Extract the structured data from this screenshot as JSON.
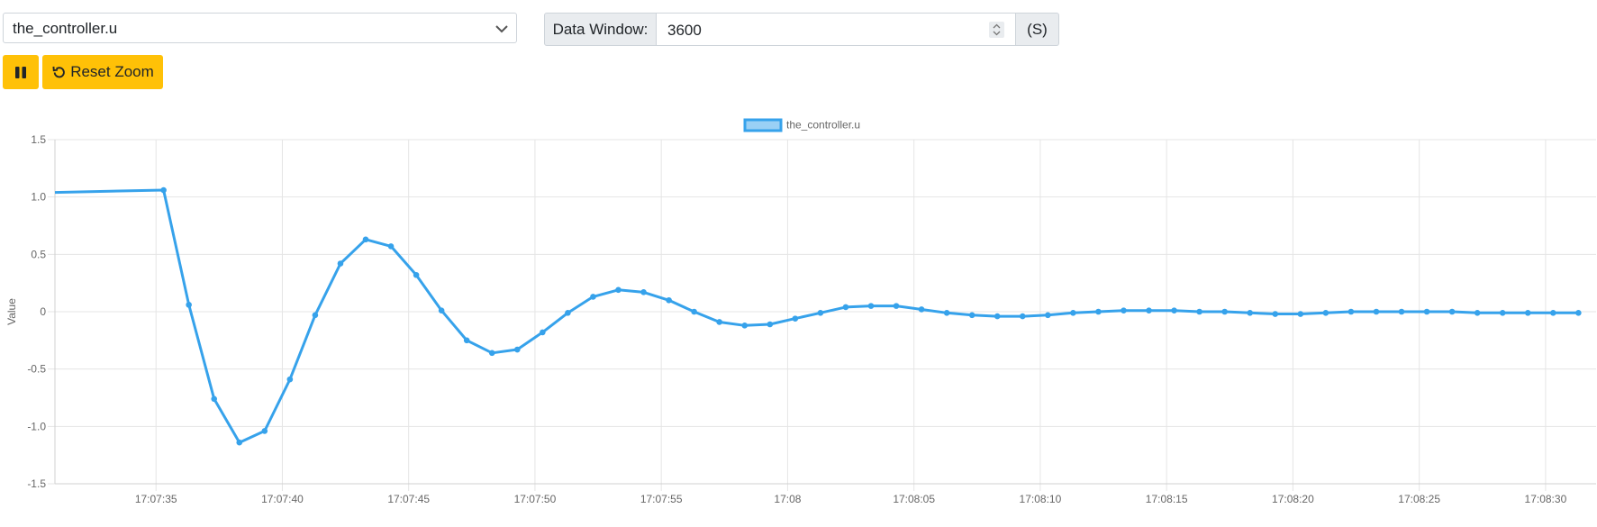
{
  "signal_select": {
    "value": "the_controller.u"
  },
  "data_window": {
    "label": "Data Window:",
    "value": "3600",
    "unit": "(S)"
  },
  "buttons": {
    "pause": "pause-icon",
    "reset_zoom": "Reset Zoom"
  },
  "colors": {
    "series": "#36a2eb",
    "series_fill": "#9ad0f5",
    "button": "#ffc107",
    "grid": "#e5e5e5"
  },
  "chart_data": {
    "type": "line",
    "ylabel": "Value",
    "ylim": [
      -1.5,
      1.5
    ],
    "yticks": [
      "1.5",
      "1.0",
      "0.5",
      "0",
      "-0.5",
      "-1.0",
      "-1.5"
    ],
    "xlim": [
      "17:07:31",
      "17:08:32"
    ],
    "xticks": [
      "17:07:35",
      "17:07:40",
      "17:07:45",
      "17:07:50",
      "17:07:55",
      "17:08",
      "17:08:05",
      "17:08:10",
      "17:08:15",
      "17:08:20",
      "17:08:25",
      "17:08:30"
    ],
    "grid": true,
    "legend_position": "top",
    "series": [
      {
        "name": "the_controller.u",
        "x": [
          "17:07:31",
          "17:07:35.3",
          "17:07:36.3",
          "17:07:37.3",
          "17:07:38.3",
          "17:07:39.3",
          "17:07:40.3",
          "17:07:41.3",
          "17:07:42.3",
          "17:07:43.3",
          "17:07:44.3",
          "17:07:45.3",
          "17:07:46.3",
          "17:07:47.3",
          "17:07:48.3",
          "17:07:49.3",
          "17:07:50.3",
          "17:07:51.3",
          "17:07:52.3",
          "17:07:53.3",
          "17:07:54.3",
          "17:07:55.3",
          "17:07:56.3",
          "17:07:57.3",
          "17:07:58.3",
          "17:07:59.3",
          "17:08:00.3",
          "17:08:01.3",
          "17:08:02.3",
          "17:08:03.3",
          "17:08:04.3",
          "17:08:05.3",
          "17:08:06.3",
          "17:08:07.3",
          "17:08:08.3",
          "17:08:09.3",
          "17:08:10.3",
          "17:08:11.3",
          "17:08:12.3",
          "17:08:13.3",
          "17:08:14.3",
          "17:08:15.3",
          "17:08:16.3",
          "17:08:17.3",
          "17:08:18.3",
          "17:08:19.3",
          "17:08:20.3",
          "17:08:21.3",
          "17:08:22.3",
          "17:08:23.3",
          "17:08:24.3",
          "17:08:25.3",
          "17:08:26.3",
          "17:08:27.3",
          "17:08:28.3",
          "17:08:29.3",
          "17:08:30.3",
          "17:08:31.3"
        ],
        "y": [
          1.04,
          1.06,
          0.06,
          -0.76,
          -1.14,
          -1.04,
          -0.59,
          -0.03,
          0.42,
          0.63,
          0.57,
          0.32,
          0.01,
          -0.25,
          -0.36,
          -0.33,
          -0.18,
          -0.01,
          0.13,
          0.19,
          0.17,
          0.1,
          0.0,
          -0.09,
          -0.12,
          -0.11,
          -0.06,
          -0.01,
          0.04,
          0.05,
          0.05,
          0.02,
          -0.01,
          -0.03,
          -0.04,
          -0.04,
          -0.03,
          -0.01,
          0.0,
          0.01,
          0.01,
          0.01,
          0.0,
          0.0,
          -0.01,
          -0.02,
          -0.02,
          -0.01,
          0.0,
          0.0,
          0.0,
          0.0,
          0.0,
          -0.01,
          -0.01,
          -0.01,
          -0.01,
          -0.01
        ]
      }
    ]
  }
}
